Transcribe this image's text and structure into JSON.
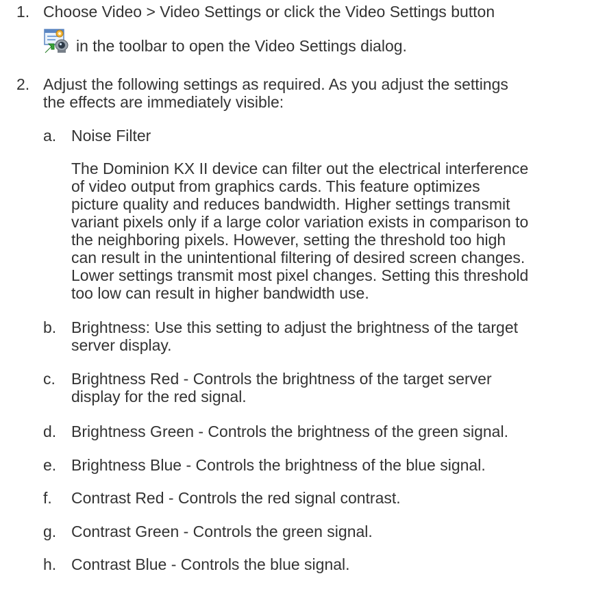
{
  "steps": [
    {
      "number": "1.",
      "lines": [
        "Choose Video > Video Settings or click the Video Settings button",
        "in the toolbar to open the Video Settings dialog."
      ],
      "icon": "video-settings-icon"
    },
    {
      "number": "2.",
      "lines": [
        "Adjust the following settings as required. As you adjust the settings",
        "the effects are immediately visible:"
      ]
    }
  ],
  "substeps": [
    {
      "letter": "a.",
      "lines": [
        "Noise Filter"
      ]
    },
    {
      "letter": "b.",
      "lines": [
        "Brightness: Use this setting to adjust the brightness of the target",
        "server display."
      ]
    },
    {
      "letter": "c.",
      "lines": [
        "Brightness Red - Controls the brightness of the target server",
        "display for the red signal."
      ]
    },
    {
      "letter": "d.",
      "lines": [
        "Brightness Green - Controls the brightness of the green signal."
      ]
    },
    {
      "letter": "e.",
      "lines": [
        "Brightness Blue - Controls the brightness of the blue signal."
      ]
    },
    {
      "letter": "f.",
      "lines": [
        "Contrast Red - Controls the red signal contrast."
      ]
    },
    {
      "letter": "g.",
      "lines": [
        "Contrast Green - Controls the green signal."
      ]
    },
    {
      "letter": "h.",
      "lines": [
        "Contrast Blue - Controls the blue signal."
      ]
    }
  ],
  "noise_filter_paragraph": [
    "The Dominion KX II device can filter out the electrical interference",
    "of video output from graphics cards. This feature optimizes",
    "picture quality and reduces bandwidth. Higher settings transmit",
    "variant pixels only if a large color variation exists in comparison to",
    "the neighboring pixels. However, setting the threshold too high",
    "can result in the unintentional filtering of desired screen changes.",
    "Lower settings transmit most pixel changes. Setting this threshold",
    "too low can result in higher bandwidth use."
  ]
}
